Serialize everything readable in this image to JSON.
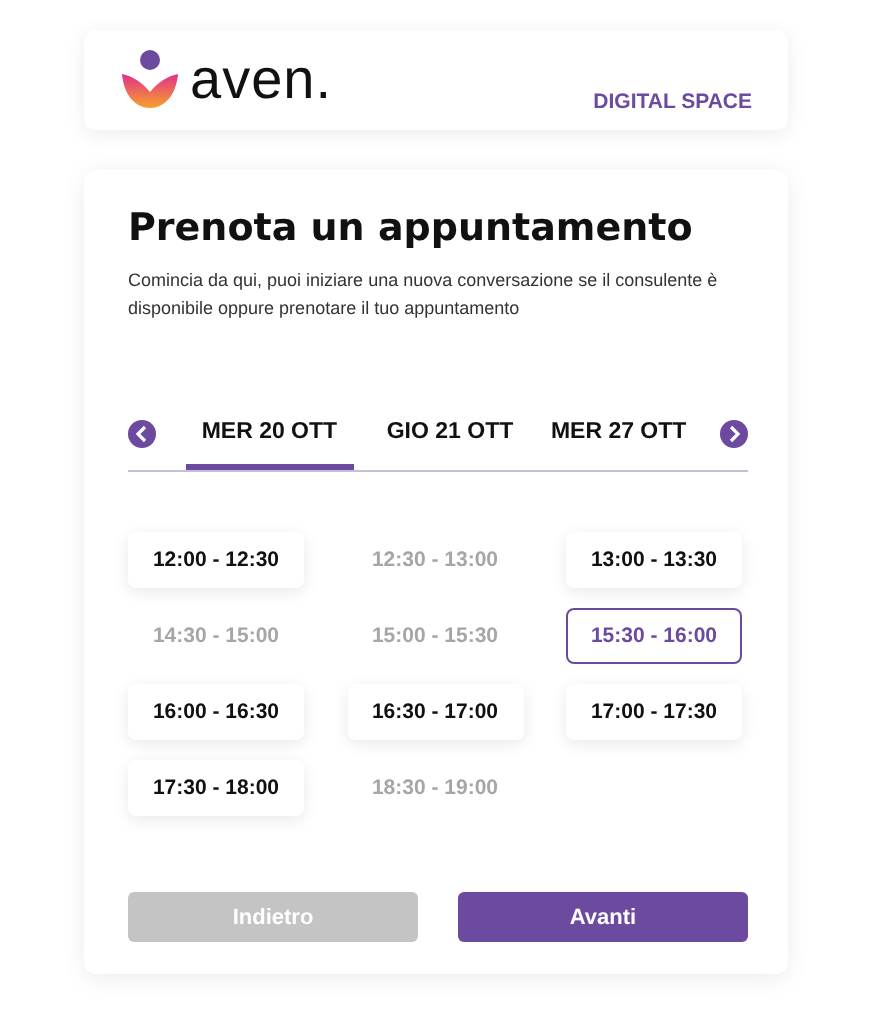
{
  "header": {
    "logo_text": "aven.",
    "section": "DIGITAL SPACE"
  },
  "title": "Prenota un appuntamento",
  "description": "Comincia da qui, puoi iniziare una nuova conversazione se il consulente è disponibile oppure prenotare il tuo appuntamento",
  "days": [
    {
      "label": "MER 20 OTT",
      "selected": true
    },
    {
      "label": "GIO 21 OTT",
      "selected": false
    },
    {
      "label": "MER 27 OTT",
      "selected": false
    }
  ],
  "slots": [
    {
      "label": "12:00 - 12:30",
      "disabled": false,
      "selected": false
    },
    {
      "label": "12:30 - 13:00",
      "disabled": true,
      "selected": false
    },
    {
      "label": "13:00 - 13:30",
      "disabled": false,
      "selected": false
    },
    {
      "label": "14:30 - 15:00",
      "disabled": true,
      "selected": false
    },
    {
      "label": "15:00 - 15:30",
      "disabled": true,
      "selected": false
    },
    {
      "label": "15:30 - 16:00",
      "disabled": false,
      "selected": true
    },
    {
      "label": "16:00 - 16:30",
      "disabled": false,
      "selected": false
    },
    {
      "label": "16:30 - 17:00",
      "disabled": false,
      "selected": false
    },
    {
      "label": "17:00 - 17:30",
      "disabled": false,
      "selected": false
    },
    {
      "label": "17:30 - 18:00",
      "disabled": false,
      "selected": false
    },
    {
      "label": "18:30 - 19:00",
      "disabled": true,
      "selected": false
    }
  ],
  "buttons": [
    {
      "label": "Indietro",
      "disabled": true
    },
    {
      "label": "Avanti",
      "disabled": false
    }
  ]
}
